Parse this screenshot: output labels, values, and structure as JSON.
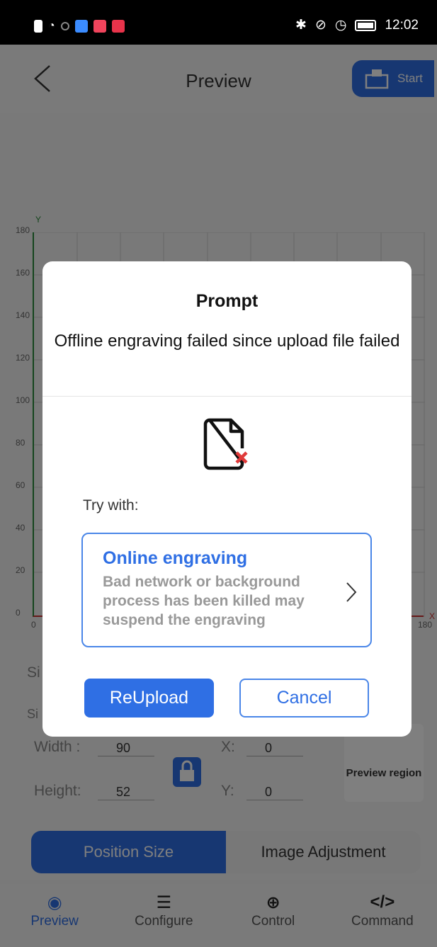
{
  "status_bar": {
    "time": "12:02",
    "icons": [
      "alert-icon",
      "wifi-icon",
      "circle-icon",
      "app-icon-blue",
      "app-icon-red",
      "app-icon-red2",
      "bluetooth-icon",
      "mute-icon",
      "speed-icon",
      "battery-icon"
    ]
  },
  "header": {
    "title": "Preview",
    "start_label": "Start"
  },
  "canvas": {
    "y_ticks": [
      "180",
      "160",
      "140",
      "120",
      "100",
      "80",
      "60",
      "40",
      "20",
      "0"
    ],
    "x_ticks": [
      "0",
      "180"
    ],
    "x_axis": "X",
    "y_axis": "Y"
  },
  "size_panel": {
    "width_label": "Width :",
    "width_value": "90",
    "height_label": "Height:",
    "height_value": "52",
    "x_label": "X:",
    "x_value": "0",
    "y_label": "Y:",
    "y_value": "0",
    "preview_region_label": "Preview region",
    "partial_label_1": "Si",
    "partial_label_2": "Si"
  },
  "segment": {
    "position_size": "Position Size",
    "image_adjustment": "Image Adjustment"
  },
  "tabs": [
    {
      "label": "Preview",
      "icon": "eye-icon"
    },
    {
      "label": "Configure",
      "icon": "sliders-icon"
    },
    {
      "label": "Control",
      "icon": "crosshair-icon"
    },
    {
      "label": "Command",
      "icon": "code-icon"
    }
  ],
  "dialog": {
    "title": "Prompt",
    "message": "Offline engraving failed since upload file failed",
    "try_label": "Try with:",
    "option_title": "Online engraving",
    "option_desc": "Bad network or background process has been killed may suspend the engraving",
    "reupload": "ReUpload",
    "cancel": "Cancel"
  },
  "colors": {
    "accent": "#2f6fe4",
    "error": "#e03a3a"
  }
}
